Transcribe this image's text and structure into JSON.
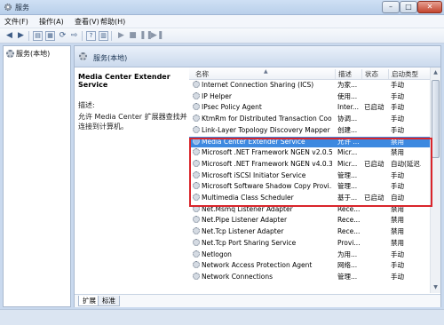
{
  "window": {
    "title": "服务",
    "minimize": "–",
    "maximize": "□",
    "close": "✕"
  },
  "menu": [
    {
      "label": "文件(F)"
    },
    {
      "label": "操作(A)"
    },
    {
      "label": "查看(V)"
    },
    {
      "label": "帮助(H)"
    }
  ],
  "toolbar": {
    "icons": [
      "back-arrow-icon",
      "forward-arrow-icon",
      "console-tree-icon",
      "properties-icon",
      "refresh-icon",
      "export-list-icon",
      "help-icon",
      "show-hide-icon",
      "play-icon",
      "stop-icon",
      "pause-icon",
      "restart-icon"
    ]
  },
  "tree": {
    "item": "服务(本地)"
  },
  "main": {
    "header_title": "服务(本地)",
    "selected_name": "Media Center Extender Service",
    "desc_label": "描述:",
    "desc_text": "允许 Media Center 扩展器查找并连接到计算机。"
  },
  "columns": {
    "name": "名称",
    "desc": "描述",
    "status": "状态",
    "startup": "启动类型"
  },
  "rows": [
    {
      "name": "Internet Connection Sharing (ICS)",
      "desc": "为家...",
      "status": "",
      "startup": "手动"
    },
    {
      "name": "IP Helper",
      "desc": "使用...",
      "status": "",
      "startup": "手动"
    },
    {
      "name": "IPsec Policy Agent",
      "desc": "Inter...",
      "status": "已启动",
      "startup": "手动"
    },
    {
      "name": "KtmRm for Distributed Transaction Coor...",
      "desc": "协调...",
      "status": "",
      "startup": "手动"
    },
    {
      "name": "Link-Layer Topology Discovery Mapper",
      "desc": "创建...",
      "status": "",
      "startup": "手动"
    },
    {
      "name": "Media Center Extender Service",
      "desc": "允许 ...",
      "status": "",
      "startup": "禁用"
    },
    {
      "name": "Microsoft .NET Framework NGEN v2.0.5...",
      "desc": "Micr...",
      "status": "",
      "startup": "禁用"
    },
    {
      "name": "Microsoft .NET Framework NGEN v4.0.3...",
      "desc": "Micr...",
      "status": "已启动",
      "startup": "自动(延迟..."
    },
    {
      "name": "Microsoft iSCSI Initiator Service",
      "desc": "管理...",
      "status": "",
      "startup": "手动"
    },
    {
      "name": "Microsoft Software Shadow Copy Provi...",
      "desc": "管理...",
      "status": "",
      "startup": "手动"
    },
    {
      "name": "Multimedia Class Scheduler",
      "desc": "基于...",
      "status": "已启动",
      "startup": "自动"
    },
    {
      "name": "Net.Msmq Listener Adapter",
      "desc": "Rece...",
      "status": "",
      "startup": "禁用"
    },
    {
      "name": "Net.Pipe Listener Adapter",
      "desc": "Rece...",
      "status": "",
      "startup": "禁用"
    },
    {
      "name": "Net.Tcp Listener Adapter",
      "desc": "Rece...",
      "status": "",
      "startup": "禁用"
    },
    {
      "name": "Net.Tcp Port Sharing Service",
      "desc": "Provi...",
      "status": "",
      "startup": "禁用"
    },
    {
      "name": "Netlogon",
      "desc": "为用...",
      "status": "",
      "startup": "手动"
    },
    {
      "name": "Network Access Protection Agent",
      "desc": "网络...",
      "status": "",
      "startup": "手动"
    },
    {
      "name": "Network Connections",
      "desc": "管理...",
      "status": "",
      "startup": "手动"
    }
  ],
  "selected_row": "Media Center Extender Service",
  "tabs": [
    {
      "label": "扩展"
    },
    {
      "label": "标准"
    }
  ],
  "colors": {
    "selection": "#3d89e0",
    "highlight_border": "#d9252b"
  }
}
